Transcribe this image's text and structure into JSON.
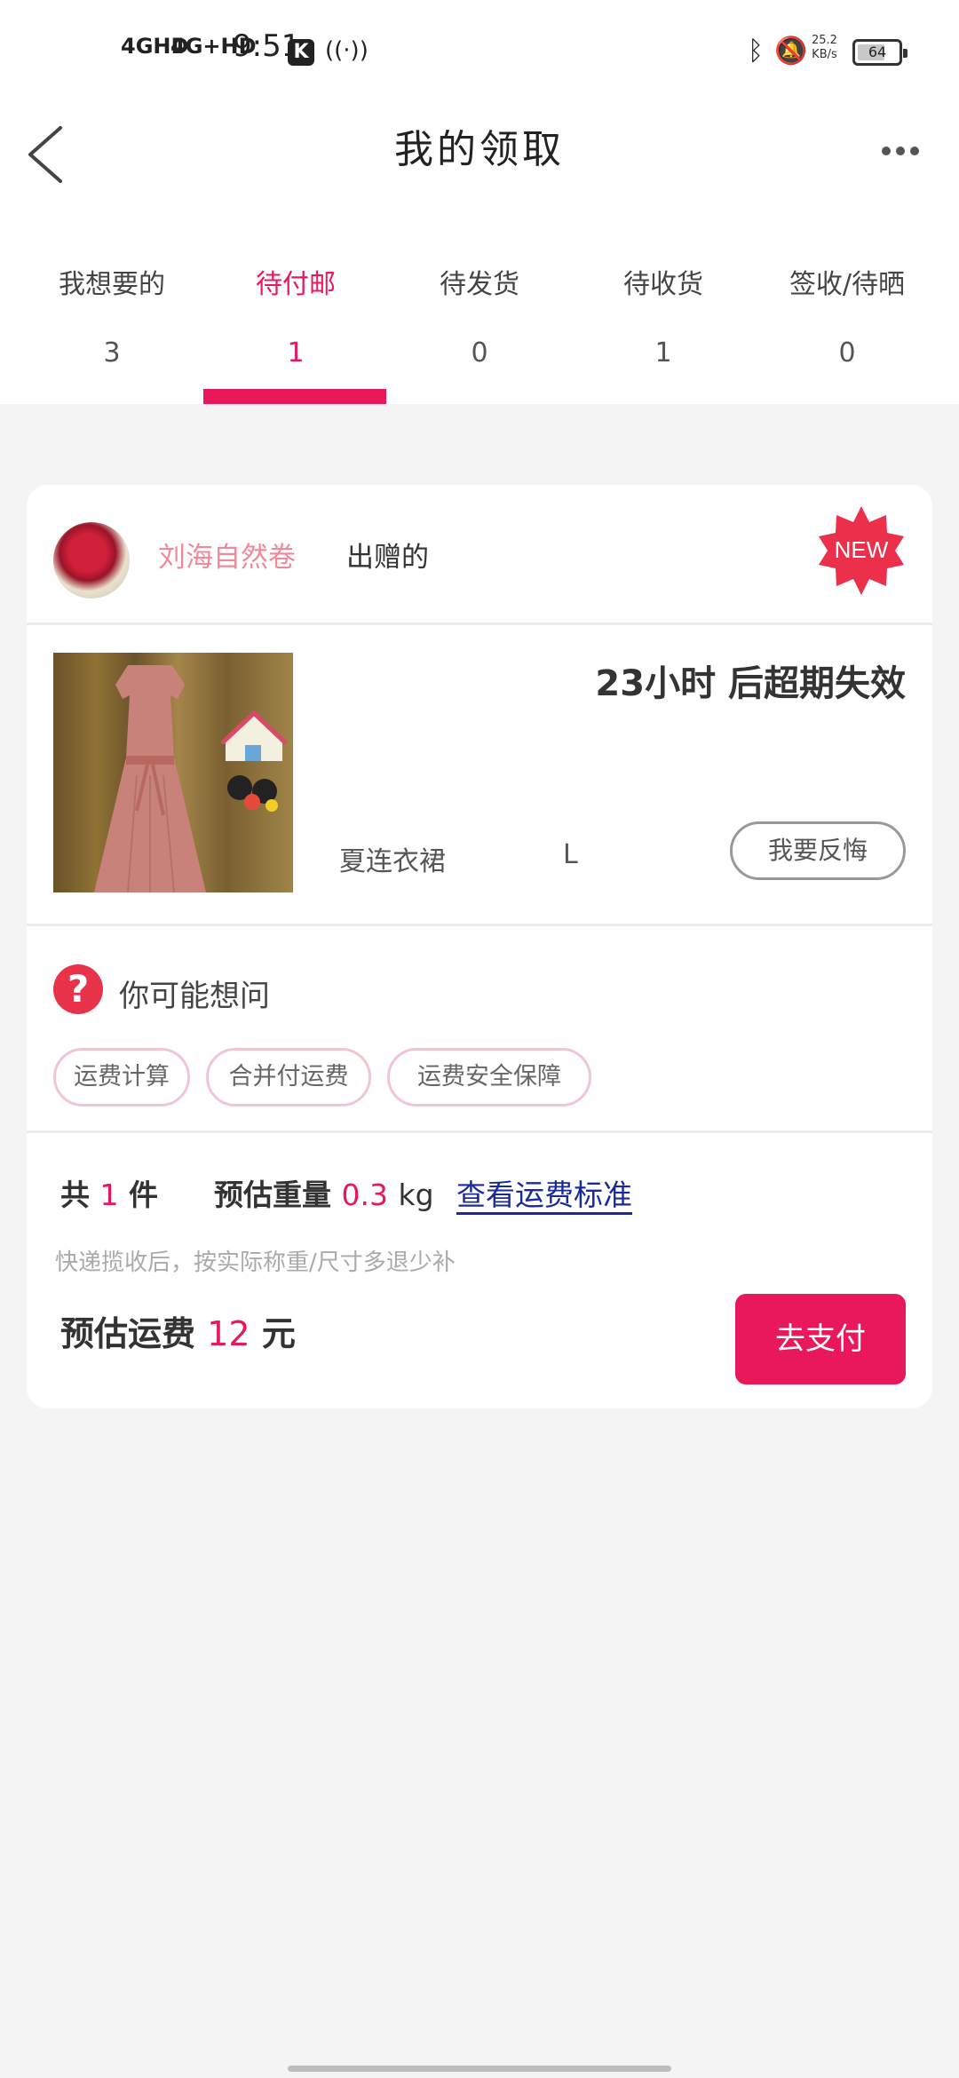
{
  "status_bar": {
    "signal_1": "4GHD",
    "signal_2": "4G+HD",
    "time": "9:51",
    "app_icon": "K",
    "speed": "25.2",
    "speed_unit": "KB/s",
    "battery": "64"
  },
  "header": {
    "title": "我的领取",
    "back_icon": "chevron-left",
    "more_icon": "more-dots"
  },
  "tabs": [
    {
      "label": "我想要的",
      "count": "3"
    },
    {
      "label": "待付邮",
      "count": "1"
    },
    {
      "label": "待发货",
      "count": "0"
    },
    {
      "label": "待收货",
      "count": "1"
    },
    {
      "label": "签收/待晒",
      "count": "0"
    }
  ],
  "active_tab": 1,
  "card": {
    "giver_name": "刘海自然卷",
    "giver_suffix": "出赠的",
    "badge": "NEW",
    "expire": "23小时 后超期失效",
    "product_name": "夏连衣裙",
    "product_size": "L",
    "regret_button": "我要反悔",
    "faq_title": "你可能想问",
    "faq_icon": "?",
    "faq_chips": [
      "运费计算",
      "合并付运费",
      "运费安全保障"
    ],
    "summary": {
      "total_prefix": "共",
      "count": "1",
      "count_unit": "件",
      "weight_label": "预估重量",
      "weight": "0.3",
      "weight_unit": "kg",
      "shipping_link": "查看运费标准",
      "note": "快递揽收后，按实际称重/尺寸多退少补",
      "fee_label": "预估运费",
      "fee": "12",
      "fee_unit": "元",
      "pay_button": "去支付"
    }
  },
  "colors": {
    "accent": "#e8185a",
    "link": "#1a2a9a",
    "giver_name": "#f08a98",
    "background": "#f4f4f4"
  }
}
